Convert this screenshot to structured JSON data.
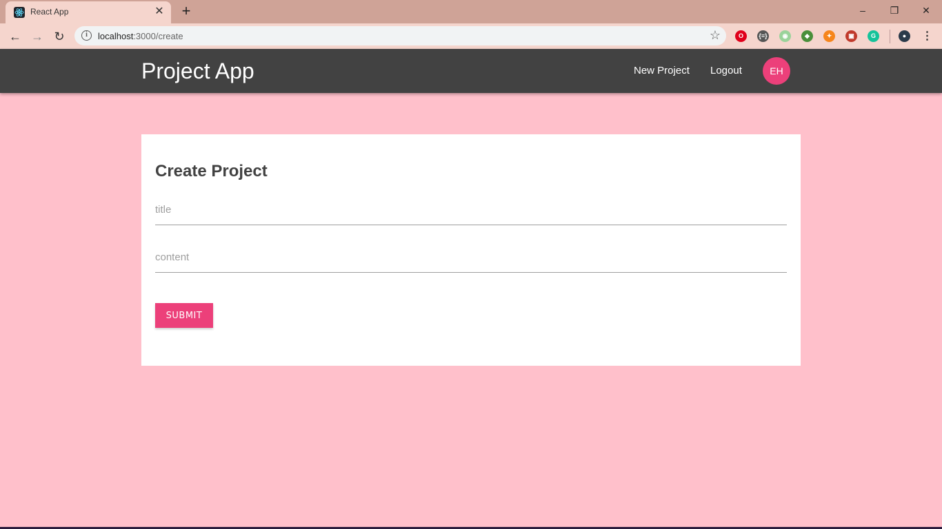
{
  "browser": {
    "tab_title": "React App",
    "url_host": "localhost",
    "url_path": ":3000/create",
    "extensions": [
      {
        "name": "opera-adblock-icon",
        "color": "#e0001b",
        "glyph": "O"
      },
      {
        "name": "json-formatter-icon",
        "color": "#555555",
        "glyph": "{≡}"
      },
      {
        "name": "extension-green-icon",
        "color": "#9ad39a",
        "glyph": "◉"
      },
      {
        "name": "extension-globe-icon",
        "color": "#4a8f3a",
        "glyph": "◆"
      },
      {
        "name": "metamask-icon",
        "color": "#f6851b",
        "glyph": "✦"
      },
      {
        "name": "extension-red-icon",
        "color": "#c0392b",
        "glyph": "▣"
      },
      {
        "name": "grammarly-icon",
        "color": "#15c39a",
        "glyph": "G"
      }
    ]
  },
  "header": {
    "brand": "Project App",
    "links": [
      "New Project",
      "Logout"
    ],
    "avatar_initials": "EH"
  },
  "form": {
    "title": "Create Project",
    "title_placeholder": "title",
    "content_placeholder": "content",
    "submit_label": "SUBMIT"
  },
  "colors": {
    "page_background": "#ffc0cb",
    "navbar": "#424242",
    "accent": "#ec407a",
    "browser_frame": "#cfa397"
  }
}
